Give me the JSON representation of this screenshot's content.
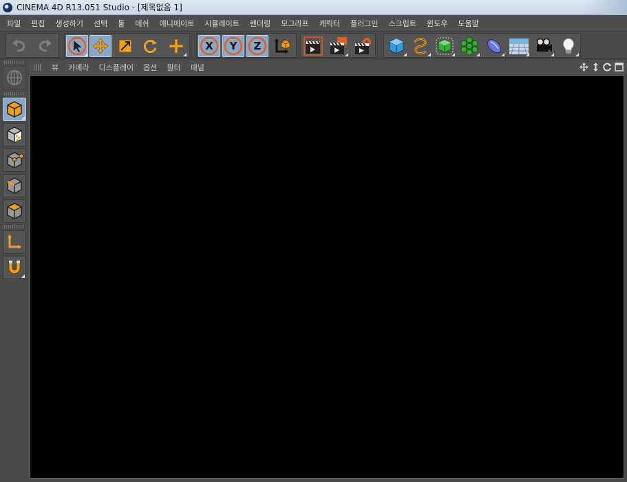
{
  "window": {
    "title": "CINEMA 4D R13.051 Studio - [제목없음 1]",
    "app_icon": "cinema4d-logo-icon"
  },
  "menu": [
    "파일",
    "편집",
    "생성하기",
    "선택",
    "툴",
    "메쉬",
    "애니메이트",
    "시뮬레이트",
    "렌더링",
    "모그라프",
    "캐릭터",
    "플러그인",
    "스크립트",
    "윈도우",
    "도움말"
  ],
  "toolbar": {
    "undo_icon": "undo-icon",
    "redo_icon": "redo-icon",
    "tools": [
      "select-arrow-icon",
      "move-icon",
      "scale-icon",
      "rotate-icon",
      "add-icon"
    ],
    "axes": [
      "X",
      "Y",
      "Z"
    ],
    "coord_icon": "coordinate-system-icon",
    "render_icons": [
      "render-view-icon",
      "render-picture-viewer-icon",
      "render-settings-icon"
    ],
    "object_icons": [
      "cube-icon",
      "spline-icon",
      "nurbs-icon",
      "array-icon",
      "deformer-icon",
      "floor-icon",
      "camera-icon",
      "light-icon"
    ]
  },
  "palette": [
    "model-mode-icon",
    "texture-mode-icon",
    "point-mode-icon",
    "edge-mode-icon",
    "polygon-mode-icon",
    "axis-mode-icon",
    "magnet-icon"
  ],
  "viewport_menu": [
    "뷰",
    "카메라",
    "디스플레이",
    "옵션",
    "필터",
    "패널"
  ],
  "colors": {
    "accent_orange": "#f0a020",
    "active_blue": "#8aa6c8",
    "ui_gray": "#4a4a4a",
    "viewport": "#000000"
  }
}
